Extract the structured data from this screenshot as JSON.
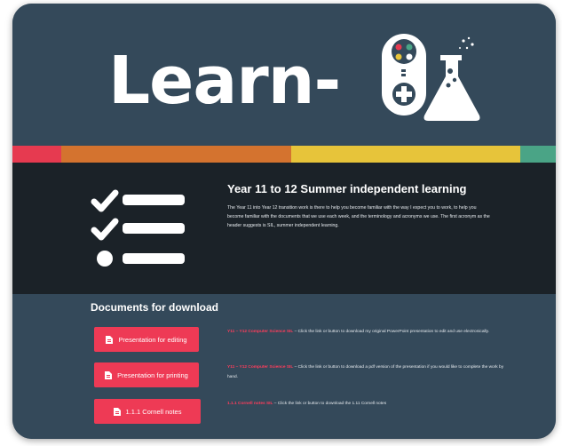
{
  "header": {
    "logo_text": "Learn-",
    "controller_icon": "game-controller-icon",
    "flask_icon": "science-flask-icon"
  },
  "stripe": {
    "colors": [
      "#e63a50",
      "#d4732f",
      "#e7c43a",
      "#4aa486"
    ]
  },
  "intro": {
    "icon": "checklist-icon",
    "title": "Year 11 to 12 Summer independent learning",
    "body": "The Year 11 into Year 12 transition work is there to help you become familiar with the way I expect you to work, to help you become familiar with  the documents that we use each week, and the terminology and acronyms we use. The first acronym as the header suggests is SIL, summer independent learning."
  },
  "docs": {
    "title": "Documents for download",
    "items": [
      {
        "button_label": "Presentation for editing",
        "link_text": "Y11 – Y12 Computer Science SIL",
        "description": " – Click the link or button to download my original PowerPoint presentation to edit and use electronically."
      },
      {
        "button_label": "Presentation for printing",
        "link_text": "Y11 – Y12 Computer Science SIL",
        "description": " – Click the link or button to download a pdf version of the presentation if you would like to complete the work by hand."
      },
      {
        "button_label": "1.1.1 Cornell notes",
        "link_text": "1.1.1 Cornell notes SIL",
        "description": " – Click the link or button to download the 1.11 Cornell notes"
      }
    ]
  },
  "colors": {
    "background": "#34495a",
    "dark_section": "#1b2228",
    "button": "#ee3a55",
    "link": "#ff3d5c"
  }
}
